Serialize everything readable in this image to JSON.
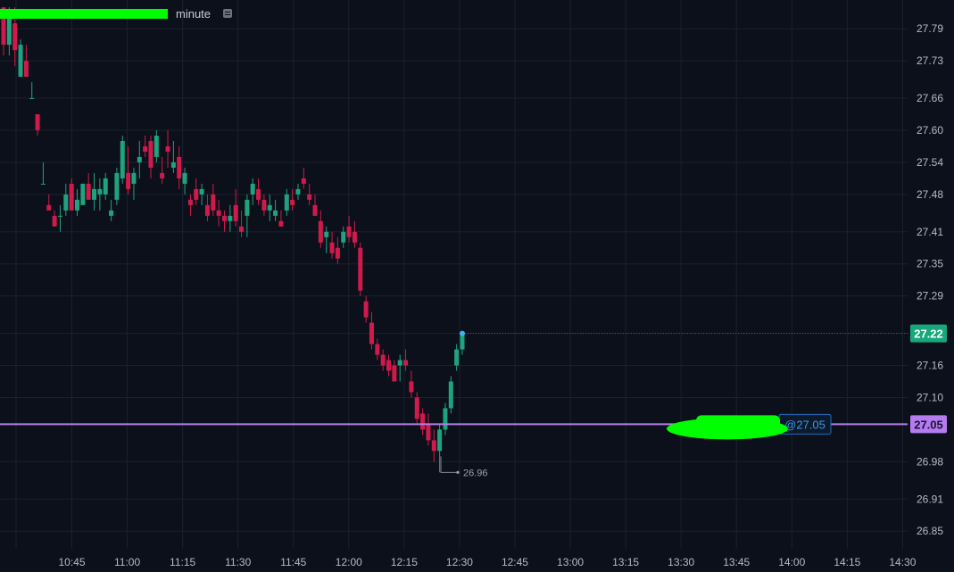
{
  "header": {
    "interval_label": "minute"
  },
  "colors": {
    "background": "#0c101a",
    "grid": "#1b2130",
    "up": "#1fa37f",
    "down": "#d01a4c",
    "last_price_badge": "#18a77c",
    "order_line": "#b57cf0",
    "order_badge_border": "#1e6fc5",
    "axis_text": "#b6bac4",
    "redaction": "#00ff00"
  },
  "chart_data": {
    "type": "candlestick",
    "x_ticks": [
      "10:45",
      "11:00",
      "11:15",
      "11:30",
      "11:45",
      "12:00",
      "12:15",
      "12:30",
      "12:45",
      "13:00",
      "13:15",
      "13:30",
      "13:45",
      "14:00",
      "14:15",
      "14:30"
    ],
    "y_ticks": [
      "27.79",
      "27.73",
      "27.66",
      "27.60",
      "27.54",
      "27.48",
      "27.41",
      "27.35",
      "27.29",
      "27.22",
      "27.16",
      "27.10",
      "27.05",
      "26.98",
      "26.91",
      "26.85"
    ],
    "ylim": [
      26.82,
      27.83
    ],
    "grid": true,
    "last_price": {
      "value": 27.22,
      "label": "27.22"
    },
    "order_line": {
      "value": 27.05,
      "label": "27.05",
      "tag": "@27.05"
    },
    "low_annotation": {
      "value": 26.96,
      "label": "26.96"
    },
    "candles": [
      [
        27.83,
        27.83,
        27.74,
        27.76
      ],
      [
        27.76,
        27.83,
        27.74,
        27.82
      ],
      [
        27.8,
        27.83,
        27.72,
        27.75
      ],
      [
        27.7,
        27.77,
        27.7,
        27.76
      ],
      [
        27.73,
        27.76,
        27.7,
        27.7
      ],
      [
        27.66,
        27.69,
        27.66,
        27.66
      ],
      [
        27.63,
        27.63,
        27.59,
        27.6
      ],
      [
        27.5,
        27.54,
        27.5,
        27.5
      ],
      [
        27.46,
        27.48,
        27.45,
        27.45
      ],
      [
        27.44,
        27.45,
        27.42,
        27.42
      ],
      [
        27.44,
        27.46,
        27.41,
        27.44
      ],
      [
        27.45,
        27.5,
        27.44,
        27.48
      ],
      [
        27.5,
        27.51,
        27.45,
        27.45
      ],
      [
        27.45,
        27.49,
        27.44,
        27.47
      ],
      [
        27.46,
        27.5,
        27.46,
        27.5
      ],
      [
        27.5,
        27.52,
        27.47,
        27.47
      ],
      [
        27.47,
        27.52,
        27.45,
        27.49
      ],
      [
        27.48,
        27.51,
        27.45,
        27.49
      ],
      [
        27.48,
        27.52,
        27.47,
        27.51
      ],
      [
        27.44,
        27.47,
        27.43,
        27.45
      ],
      [
        27.47,
        27.53,
        27.46,
        27.52
      ],
      [
        27.51,
        27.59,
        27.5,
        27.58
      ],
      [
        27.52,
        27.57,
        27.48,
        27.49
      ],
      [
        27.5,
        27.53,
        27.47,
        27.52
      ],
      [
        27.54,
        27.58,
        27.51,
        27.55
      ],
      [
        27.57,
        27.59,
        27.55,
        27.56
      ],
      [
        27.58,
        27.59,
        27.51,
        27.53
      ],
      [
        27.55,
        27.6,
        27.54,
        27.59
      ],
      [
        27.52,
        27.55,
        27.5,
        27.51
      ],
      [
        27.57,
        27.6,
        27.53,
        27.56
      ],
      [
        27.53,
        27.58,
        27.52,
        27.54
      ],
      [
        27.55,
        27.57,
        27.49,
        27.51
      ],
      [
        27.5,
        27.53,
        27.48,
        27.52
      ],
      [
        27.47,
        27.48,
        27.44,
        27.46
      ],
      [
        27.49,
        27.51,
        27.46,
        27.47
      ],
      [
        27.48,
        27.5,
        27.46,
        27.49
      ],
      [
        27.46,
        27.48,
        27.43,
        27.44
      ],
      [
        27.48,
        27.5,
        27.44,
        27.45
      ],
      [
        27.45,
        27.47,
        27.42,
        27.44
      ],
      [
        27.44,
        27.45,
        27.41,
        27.43
      ],
      [
        27.43,
        27.46,
        27.41,
        27.44
      ],
      [
        27.46,
        27.49,
        27.42,
        27.43
      ],
      [
        27.42,
        27.45,
        27.4,
        27.41
      ],
      [
        27.44,
        27.48,
        27.4,
        27.47
      ],
      [
        27.48,
        27.51,
        27.46,
        27.5
      ],
      [
        27.49,
        27.51,
        27.46,
        27.47
      ],
      [
        27.47,
        27.48,
        27.44,
        27.45
      ],
      [
        27.45,
        27.48,
        27.43,
        27.46
      ],
      [
        27.44,
        27.47,
        27.43,
        27.45
      ],
      [
        27.43,
        27.45,
        27.42,
        27.42
      ],
      [
        27.45,
        27.49,
        27.44,
        27.48
      ],
      [
        27.47,
        27.49,
        27.45,
        27.46
      ],
      [
        27.48,
        27.5,
        27.47,
        27.49
      ],
      [
        27.51,
        27.53,
        27.49,
        27.5
      ],
      [
        27.48,
        27.5,
        27.46,
        27.47
      ],
      [
        27.46,
        27.48,
        27.44,
        27.44
      ],
      [
        27.43,
        27.45,
        27.38,
        27.39
      ],
      [
        27.4,
        27.42,
        27.37,
        27.41
      ],
      [
        27.39,
        27.41,
        27.36,
        27.37
      ],
      [
        27.38,
        27.4,
        27.35,
        27.36
      ],
      [
        27.39,
        27.42,
        27.38,
        27.41
      ],
      [
        27.42,
        27.44,
        27.39,
        27.4
      ],
      [
        27.41,
        27.43,
        27.38,
        27.39
      ],
      [
        27.38,
        27.39,
        27.29,
        27.3
      ],
      [
        27.28,
        27.29,
        27.24,
        27.25
      ],
      [
        27.24,
        27.26,
        27.19,
        27.2
      ],
      [
        27.2,
        27.21,
        27.17,
        27.18
      ],
      [
        27.18,
        27.19,
        27.15,
        27.16
      ],
      [
        27.17,
        27.18,
        27.14,
        27.15
      ],
      [
        27.16,
        27.17,
        27.13,
        27.13
      ],
      [
        27.16,
        27.18,
        27.13,
        27.17
      ],
      [
        27.17,
        27.19,
        27.15,
        27.16
      ],
      [
        27.13,
        27.15,
        27.1,
        27.11
      ],
      [
        27.1,
        27.11,
        27.05,
        27.06
      ],
      [
        27.07,
        27.08,
        27.03,
        27.04
      ],
      [
        27.05,
        27.07,
        27.01,
        27.02
      ],
      [
        27.02,
        27.04,
        26.98,
        27.0
      ],
      [
        27.0,
        27.05,
        26.96,
        27.04
      ],
      [
        27.04,
        27.09,
        27.03,
        27.08
      ],
      [
        27.08,
        27.14,
        27.07,
        27.13
      ],
      [
        27.16,
        27.2,
        27.15,
        27.19
      ],
      [
        27.19,
        27.22,
        27.18,
        27.22
      ]
    ]
  }
}
